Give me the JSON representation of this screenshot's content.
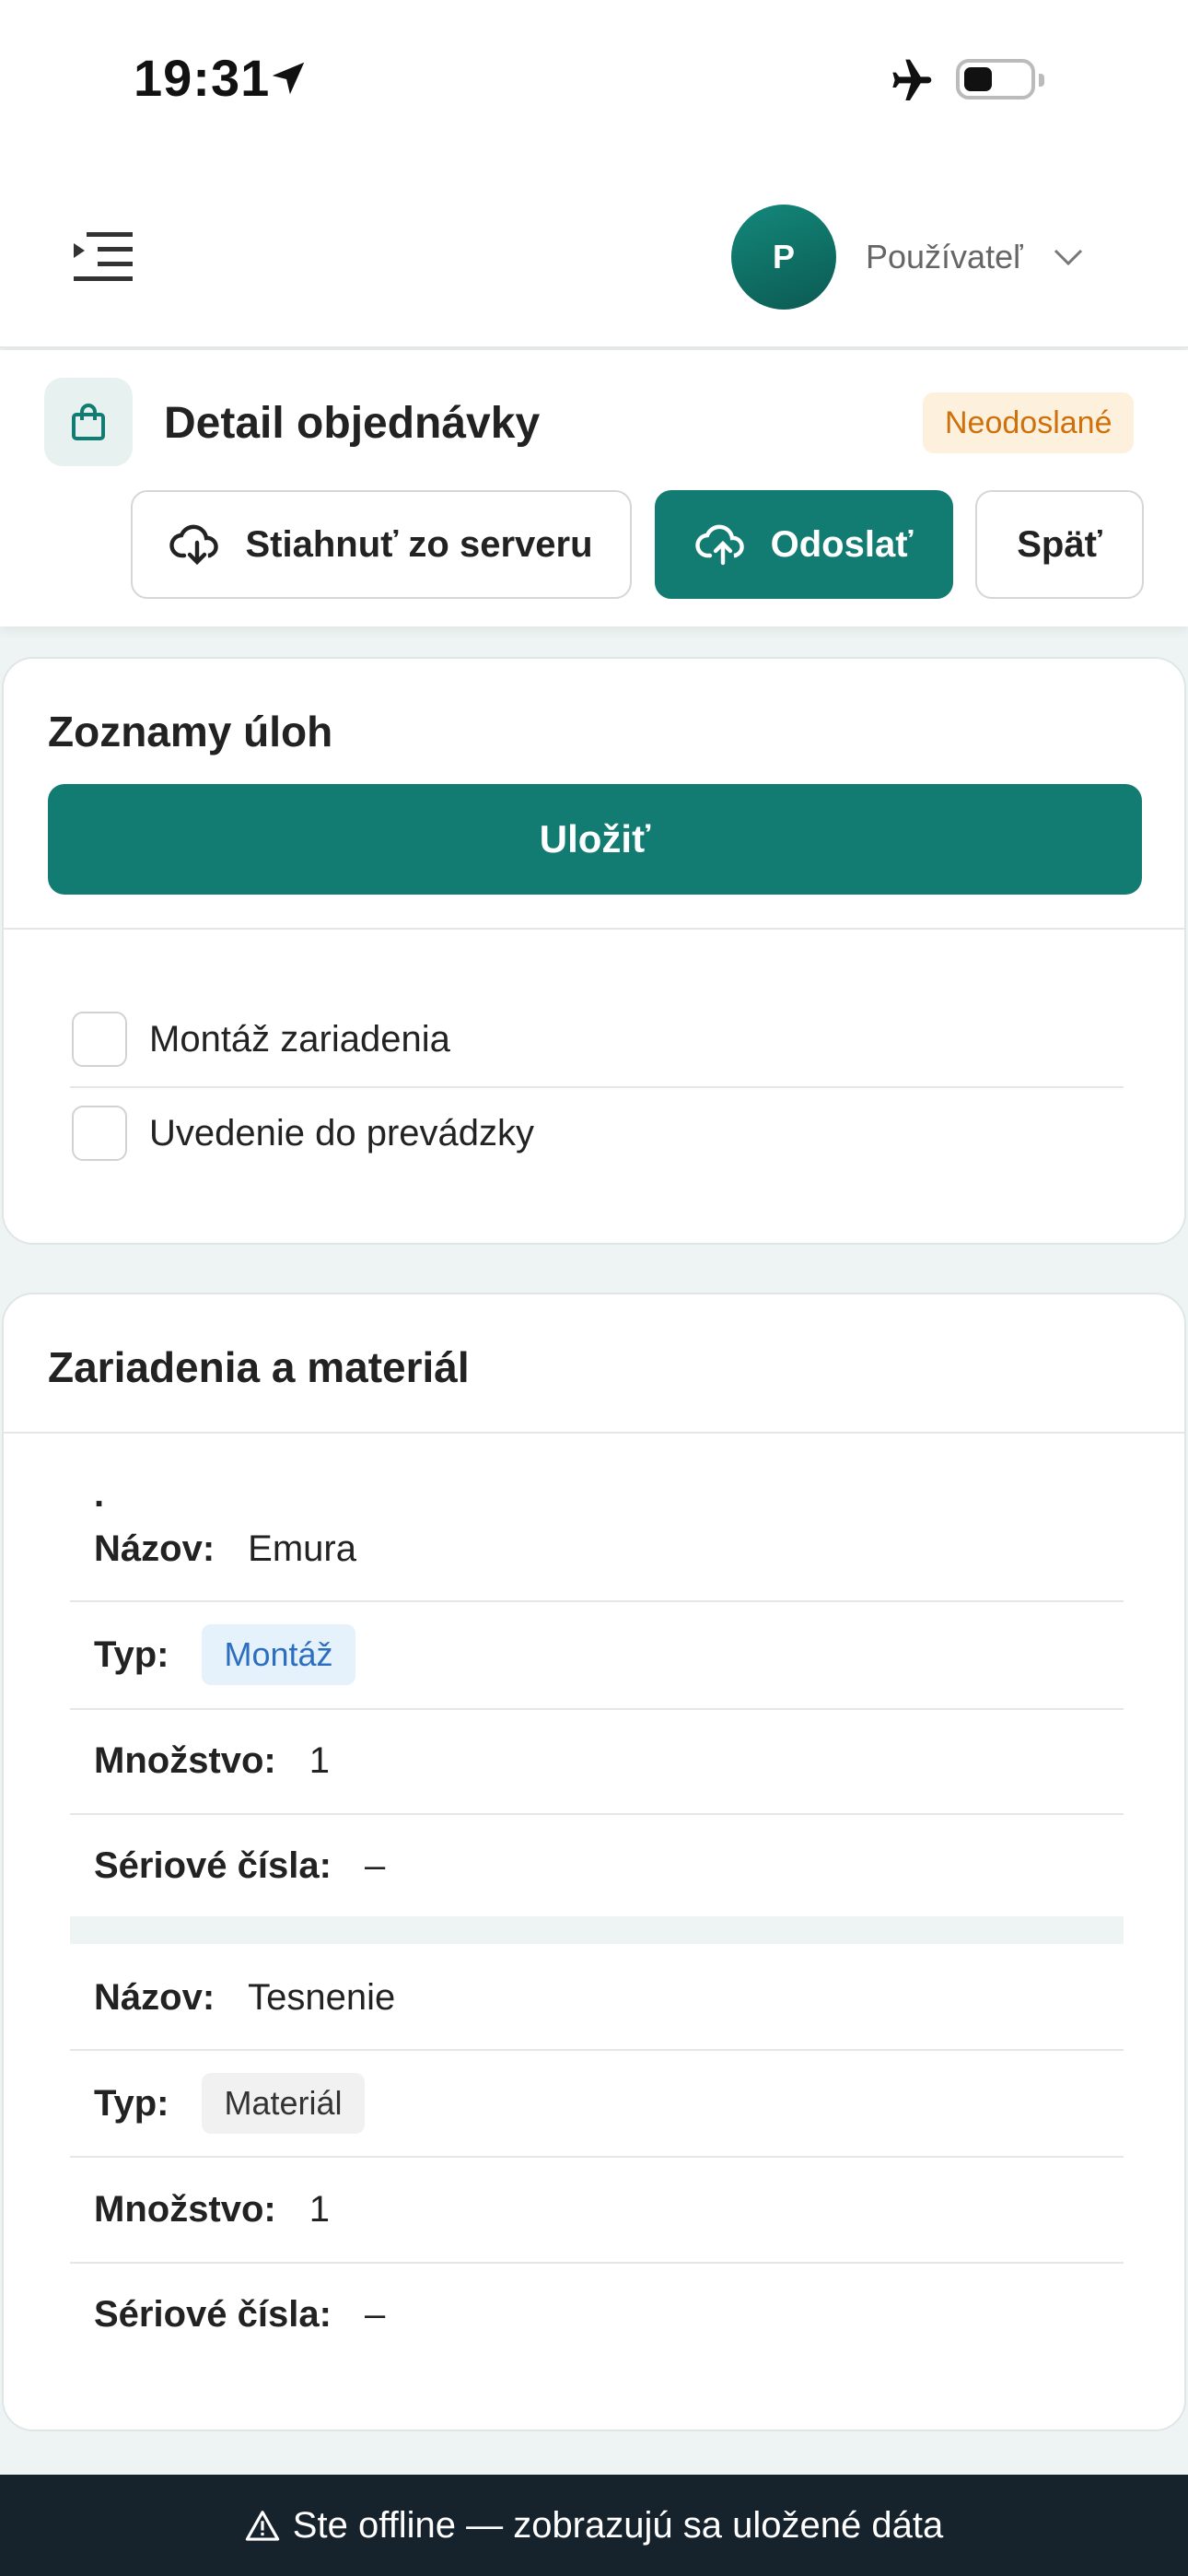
{
  "status_bar": {
    "time": "19:31"
  },
  "header": {
    "avatar_initial": "P",
    "username": "Používateľ"
  },
  "order": {
    "title": "Detail objednávky",
    "status": "Neodoslané",
    "buttons": {
      "download": "Stiahnuť zo serveru",
      "send": "Odoslať",
      "back": "Späť"
    }
  },
  "tasks": {
    "title": "Zoznamy úloh",
    "save_label": "Uložiť",
    "items": [
      {
        "label": "Montáž zariadenia",
        "checked": false
      },
      {
        "label": "Uvedenie do prevádzky",
        "checked": false
      }
    ]
  },
  "equipment": {
    "title": "Zariadenia a materiál",
    "marker": ".",
    "labels": {
      "name": "Názov:",
      "type": "Typ:",
      "quantity": "Množstvo:",
      "serials": "Sériové čísla:"
    },
    "items": [
      {
        "name": "Emura",
        "type": "Montáž",
        "quantity": "1",
        "serials": "–"
      },
      {
        "name": "Tesnenie",
        "type": "Materiál",
        "quantity": "1",
        "serials": "–"
      }
    ]
  },
  "offline_banner": "Ste offline — zobrazujú sa uložené dáta",
  "colors": {
    "primary": "#127c73",
    "badge_text": "#d0700a",
    "badge_bg": "#fdf0dc",
    "banner_bg": "#17232c"
  }
}
